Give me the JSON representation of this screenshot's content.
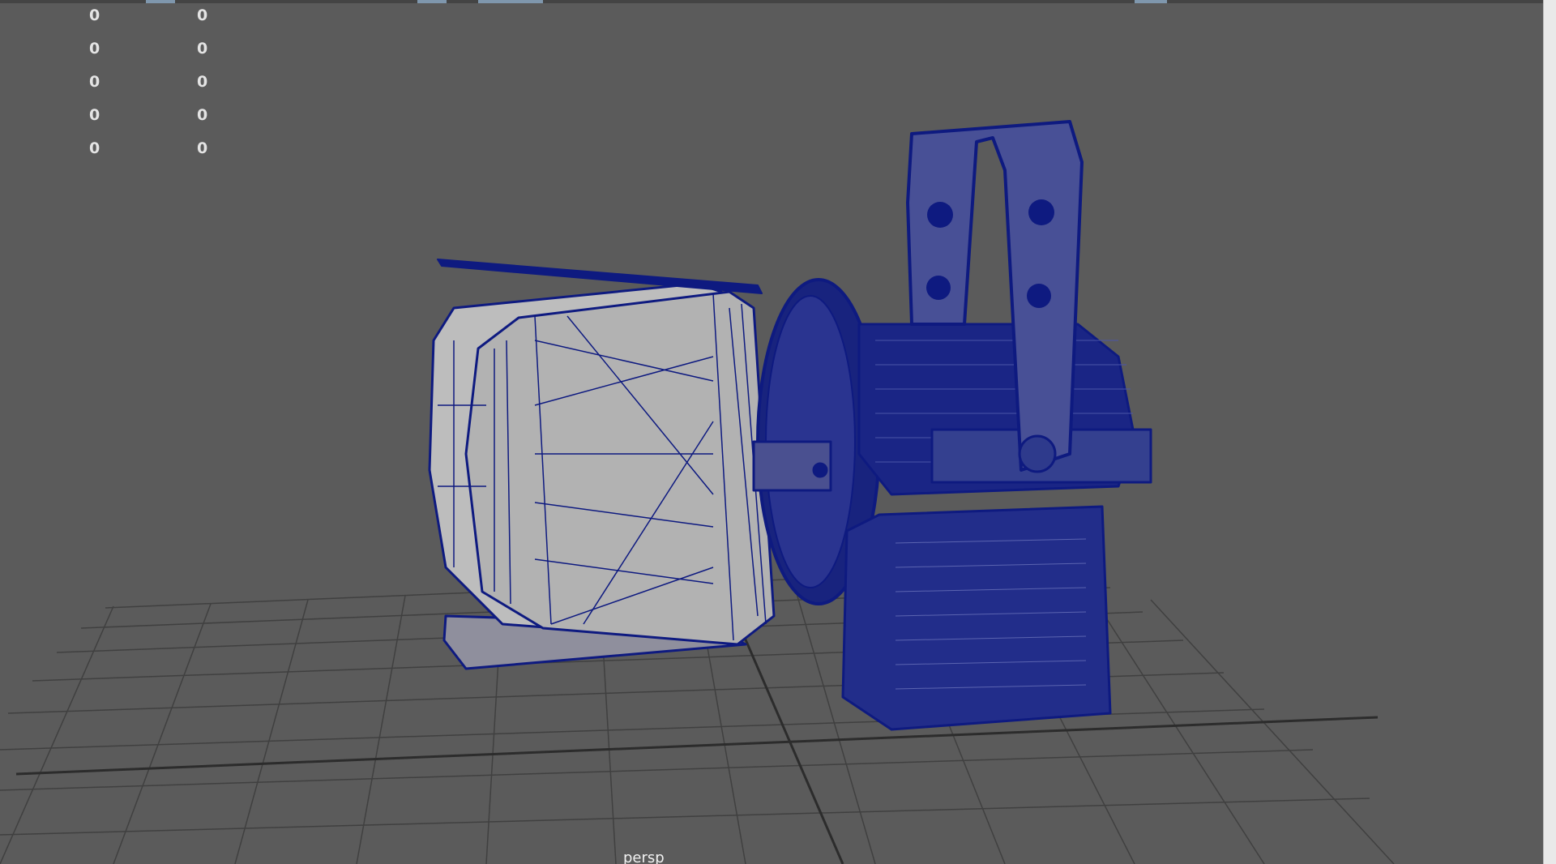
{
  "viewport": {
    "camera": "persp",
    "stats": [
      {
        "col1": "0",
        "col2": "0"
      },
      {
        "col1": "0",
        "col2": "0"
      },
      {
        "col1": "0",
        "col2": "0"
      },
      {
        "col1": "0",
        "col2": "0"
      },
      {
        "col1": "0",
        "col2": "0"
      }
    ],
    "colors": {
      "background": "#5b5b5b",
      "grid": "#3f3f3f",
      "wireframe": "#0e1a80",
      "shaded_face": "#b4b4b4"
    }
  }
}
